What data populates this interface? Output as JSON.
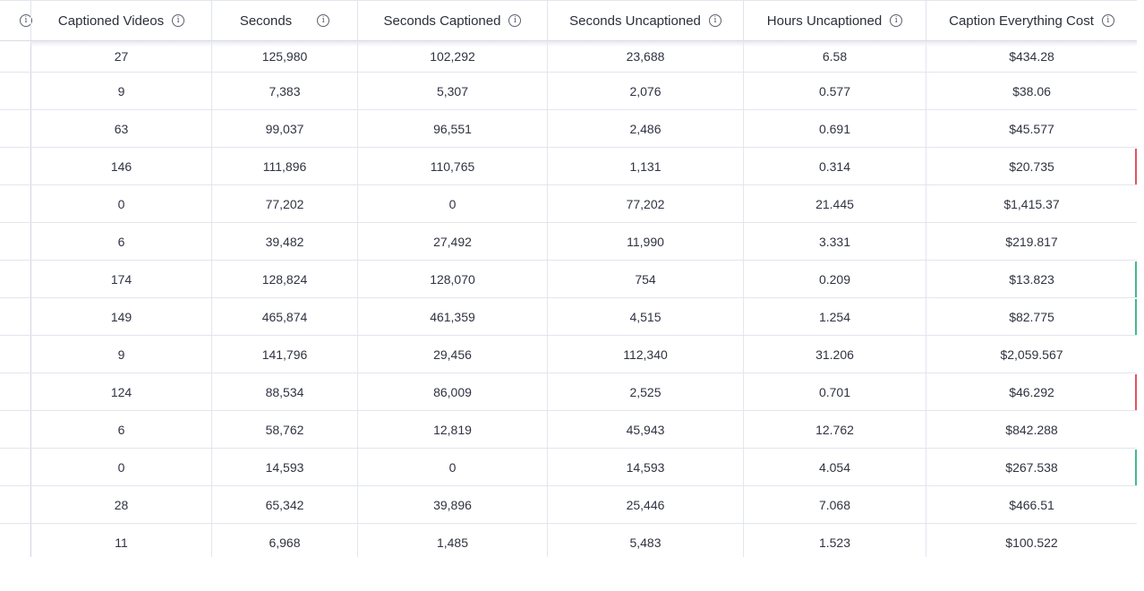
{
  "table": {
    "columns": [
      {
        "label": "Captioned Videos"
      },
      {
        "label": "Seconds"
      },
      {
        "label": "Seconds Captioned"
      },
      {
        "label": "Seconds Uncaptioned"
      },
      {
        "label": "Hours Uncaptioned"
      },
      {
        "label": "Caption Everything Cost"
      }
    ],
    "rows": [
      [
        "27",
        "125,980",
        "102,292",
        "23,688",
        "6.58",
        "$434.28"
      ],
      [
        "9",
        "7,383",
        "5,307",
        "2,076",
        "0.577",
        "$38.06"
      ],
      [
        "63",
        "99,037",
        "96,551",
        "2,486",
        "0.691",
        "$45.577"
      ],
      [
        "146",
        "111,896",
        "110,765",
        "1,131",
        "0.314",
        "$20.735"
      ],
      [
        "0",
        "77,202",
        "0",
        "77,202",
        "21.445",
        "$1,415.37"
      ],
      [
        "6",
        "39,482",
        "27,492",
        "11,990",
        "3.331",
        "$219.817"
      ],
      [
        "174",
        "128,824",
        "128,070",
        "754",
        "0.209",
        "$13.823"
      ],
      [
        "149",
        "465,874",
        "461,359",
        "4,515",
        "1.254",
        "$82.775"
      ],
      [
        "9",
        "141,796",
        "29,456",
        "112,340",
        "31.206",
        "$2,059.567"
      ],
      [
        "124",
        "88,534",
        "86,009",
        "2,525",
        "0.701",
        "$46.292"
      ],
      [
        "6",
        "58,762",
        "12,819",
        "45,943",
        "12.762",
        "$842.288"
      ],
      [
        "0",
        "14,593",
        "0",
        "14,593",
        "4.054",
        "$267.538"
      ],
      [
        "28",
        "65,342",
        "39,896",
        "25,446",
        "7.068",
        "$466.51"
      ],
      [
        "11",
        "6,968",
        "1,485",
        "5,483",
        "1.523",
        "$100.522"
      ]
    ],
    "row_status_colors": [
      "",
      "",
      "",
      "#e05561",
      "",
      "",
      "#46b98a",
      "#46b98a",
      "",
      "#e05561",
      "",
      "#46b98a",
      "",
      ""
    ],
    "icons": {
      "info": "info-icon"
    }
  }
}
